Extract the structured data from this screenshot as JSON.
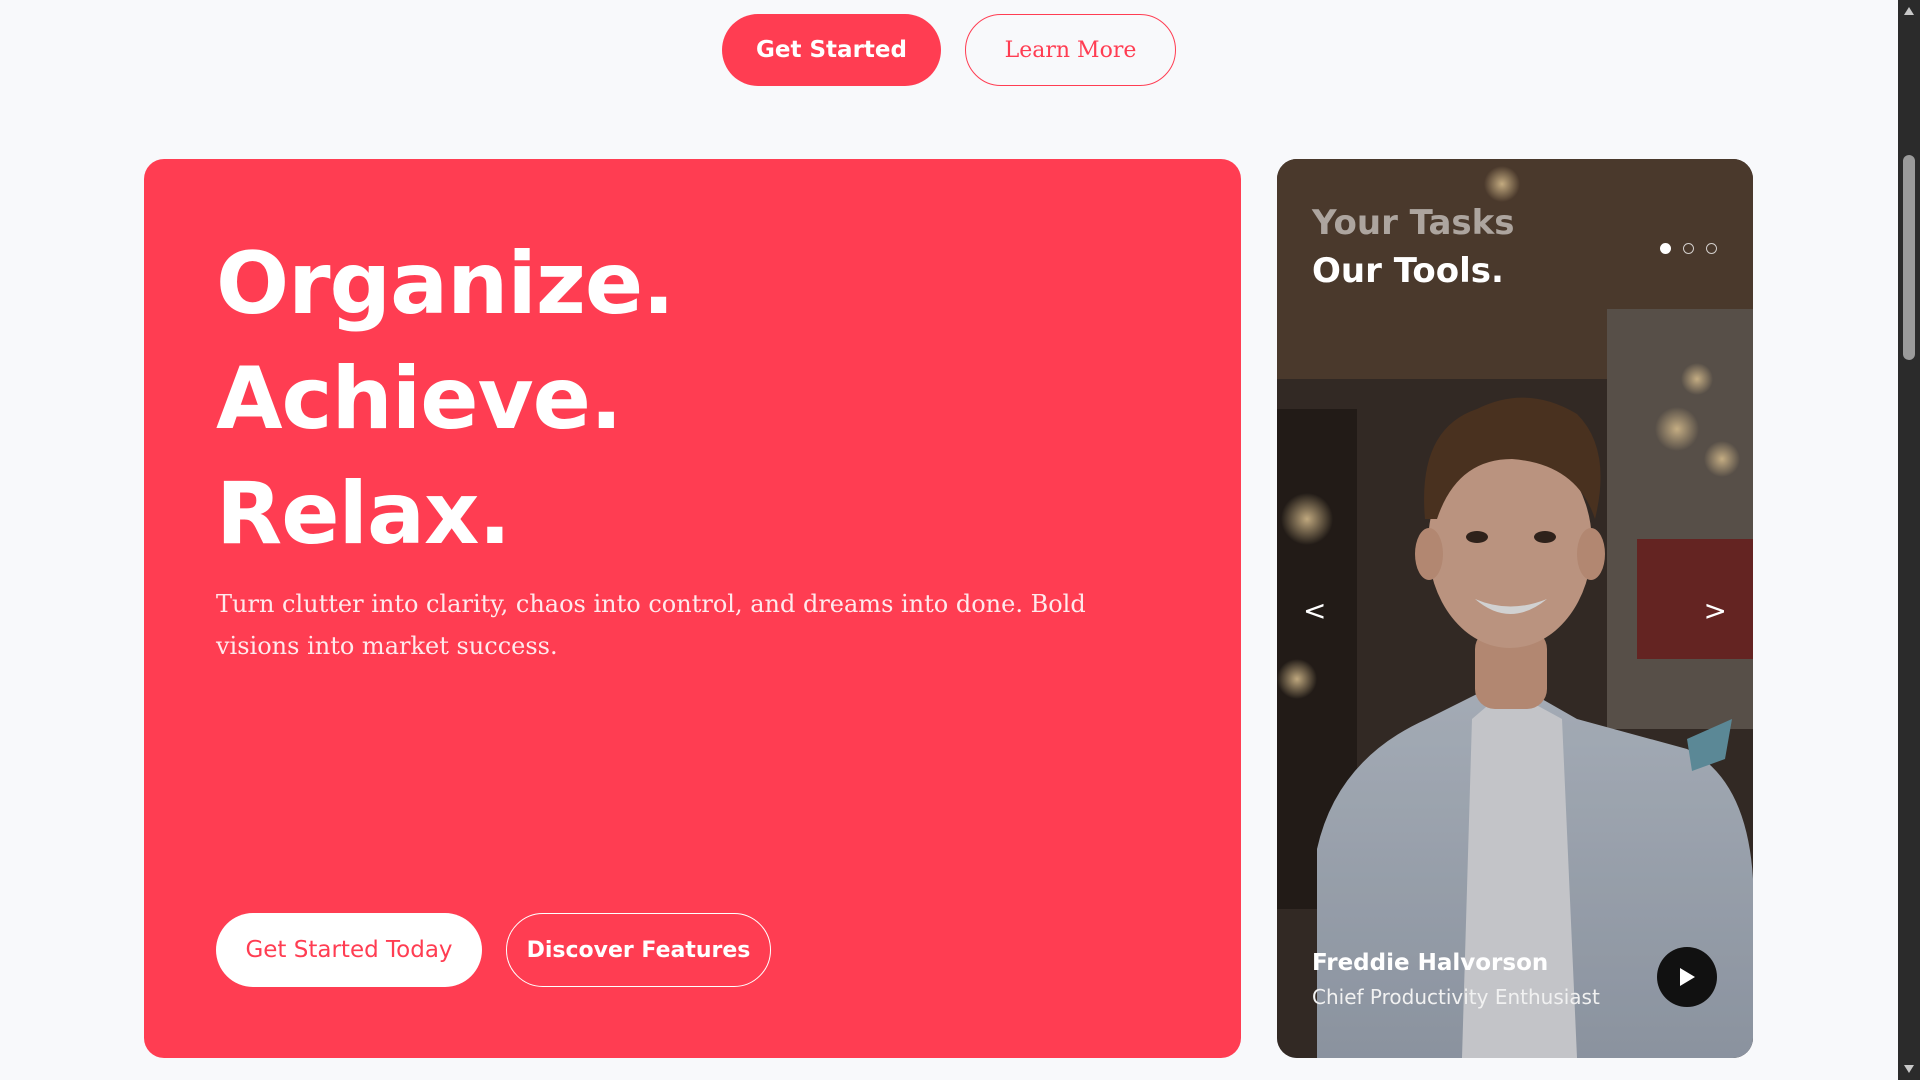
{
  "top_buttons": {
    "primary_label": "Get Started",
    "secondary_label": "Learn More"
  },
  "hero": {
    "title_lines": [
      "Organize.",
      "Achieve.",
      "Relax."
    ],
    "description": "Turn clutter into clarity, chaos into control, and dreams into done. Bold visions into market success.",
    "primary_button": "Get Started Today",
    "secondary_button": "Discover Features"
  },
  "profile_card": {
    "headline_line1": "Your Tasks",
    "headline_line2": "Our Tools.",
    "slide_dots": {
      "total": 3,
      "active_index": 0
    },
    "prev_arrow": "<",
    "next_arrow": ">",
    "person_name": "Freddie Halvorson",
    "person_role": "Chief Productivity Enthusiast",
    "play_icon": "play-icon"
  },
  "colors": {
    "accent": "#ff3d52",
    "background": "#f8f9fb",
    "white": "#ffffff",
    "dark": "#111111"
  }
}
